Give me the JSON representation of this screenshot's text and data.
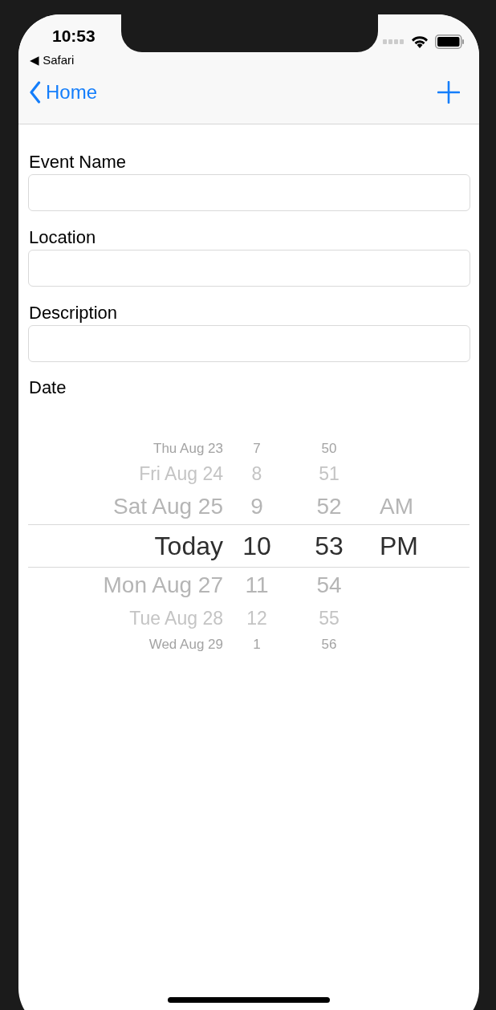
{
  "status_bar": {
    "time": "10:53",
    "back_app": "◀ Safari"
  },
  "nav_bar": {
    "back_label": "Home"
  },
  "fields": [
    {
      "label": "Event Name"
    },
    {
      "label": "Location"
    },
    {
      "label": "Description"
    }
  ],
  "date_picker": {
    "label": "Date",
    "rows": [
      {
        "date": "Thu Aug 23",
        "hour": "7",
        "minute": "50",
        "selected": false
      },
      {
        "date": "Fri Aug 24",
        "hour": "8",
        "minute": "51",
        "selected": false
      },
      {
        "date": "Sat Aug 25",
        "hour": "9",
        "minute": "52",
        "period": "AM",
        "selected": false
      },
      {
        "date": "Today",
        "hour": "10",
        "minute": "53",
        "period": "PM",
        "selected": true
      },
      {
        "date": "Mon Aug 27",
        "hour": "11",
        "minute": "54",
        "selected": false
      },
      {
        "date": "Tue Aug 28",
        "hour": "12",
        "minute": "55",
        "selected": false
      },
      {
        "date": "Wed Aug 29",
        "hour": "1",
        "minute": "56",
        "selected": false
      }
    ]
  }
}
